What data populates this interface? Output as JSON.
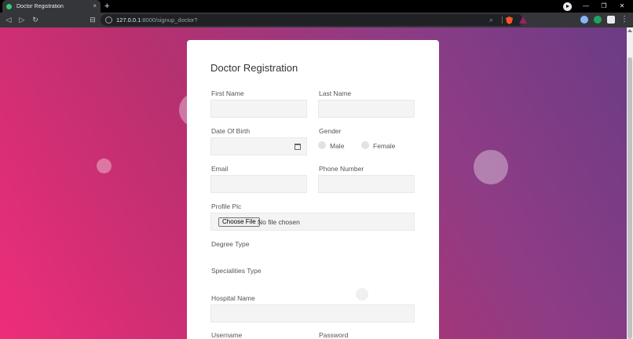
{
  "browser": {
    "tab_title": "Doctor Registration",
    "tab_close": "×",
    "new_tab": "+",
    "url_host": "127.0.0.1",
    "url_path": ":8000/signup_doctor?",
    "nav": {
      "back": "◁",
      "forward": "▷",
      "reload": "↻",
      "bookmark": "⊟"
    },
    "window": {
      "minimize": "—",
      "maximize": "❐",
      "close": "✕"
    },
    "menu": "⋮",
    "zoom_icon": "⌕",
    "extension_colors": [
      "#8ab4f8",
      "#1ea362",
      "#e8eaed"
    ]
  },
  "form": {
    "title": "Doctor Registration",
    "first_name_label": "First Name",
    "last_name_label": "Last Name",
    "dob_label": "Date Of Birth",
    "gender_label": "Gender",
    "gender_male": "Male",
    "gender_female": "Female",
    "email_label": "Email",
    "phone_label": "Phone Number",
    "profile_pic_label": "Profile Pic",
    "choose_file": "Choose File",
    "no_file": "No file chosen",
    "degree_label": "Degree Type",
    "specialities_label": "Specialities Type",
    "hospital_label": "Hospital Name",
    "username_label": "Username",
    "password_label": "Password"
  },
  "colors": {
    "gradient_start": "#ee2d7a",
    "gradient_end": "#6b3c85",
    "card_bg": "#ffffff",
    "field_bg": "#f4f4f4"
  }
}
